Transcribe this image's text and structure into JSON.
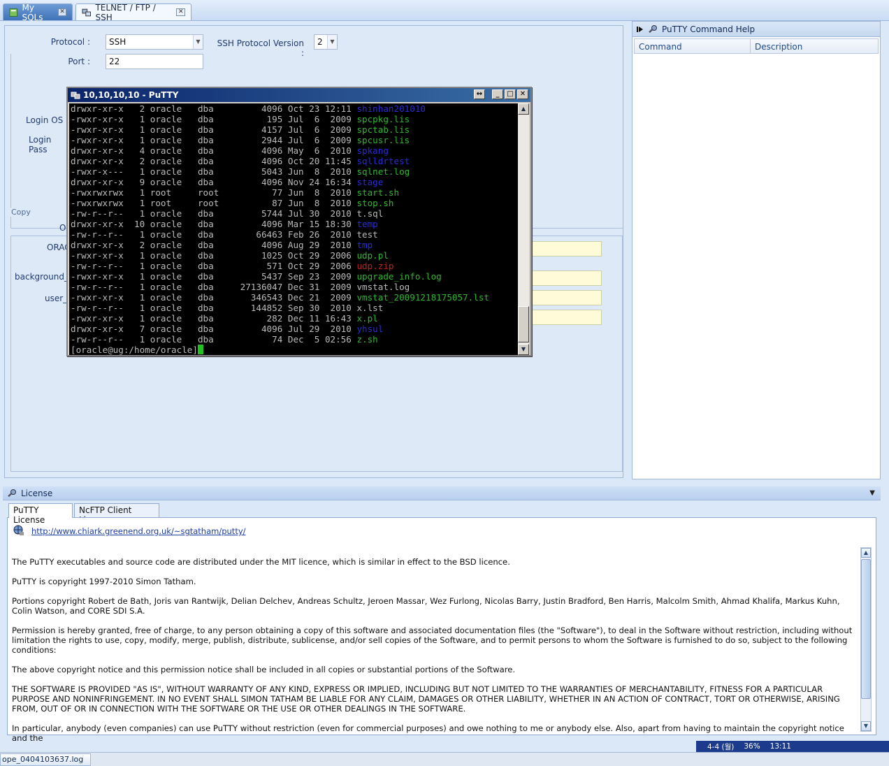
{
  "tabs": [
    {
      "label": "My SQLs",
      "active": false
    },
    {
      "label": "TELNET / FTP / SSH",
      "active": true
    }
  ],
  "form": {
    "protocol_label": "Protocol :",
    "protocol_value": "SSH",
    "ssh_version_label": "SSH Protocol Version :",
    "ssh_version_value": "2",
    "port_label": "Port :",
    "port_value": "22",
    "login_os_label": "Login OS",
    "login_pass_label": "Login Pass",
    "copy_legend": "Copy",
    "o_label": "O",
    "orac_label": "ORAC",
    "background_label": "background_c",
    "user_label": "user_c"
  },
  "putty": {
    "title": "10,10,10,10 - PuTTY",
    "lines": [
      {
        "p": "drwxr-xr-x   2 oracle   dba         4096 Oct 23 12:11 ",
        "n": "shinhan201010",
        "c": "c-blue"
      },
      {
        "p": "-rwxr-xr-x   1 oracle   dba          195 Jul  6  2009 ",
        "n": "spcpkg.lis",
        "c": "c-green"
      },
      {
        "p": "-rwxr-xr-x   1 oracle   dba         4157 Jul  6  2009 ",
        "n": "spctab.lis",
        "c": "c-green"
      },
      {
        "p": "-rwxr-xr-x   1 oracle   dba         2944 Jul  6  2009 ",
        "n": "spcusr.lis",
        "c": "c-green"
      },
      {
        "p": "drwxr-xr-x   4 oracle   dba         4096 May  6  2010 ",
        "n": "spkang",
        "c": "c-blue"
      },
      {
        "p": "drwxr-xr-x   2 oracle   dba         4096 Oct 20 11:45 ",
        "n": "sqlldrtest",
        "c": "c-blue"
      },
      {
        "p": "-rwxr-x---   1 oracle   dba         5043 Jun  8  2010 ",
        "n": "sqlnet.log",
        "c": "c-green"
      },
      {
        "p": "drwxr-xr-x   9 oracle   dba         4096 Nov 24 16:34 ",
        "n": "stage",
        "c": "c-blue"
      },
      {
        "p": "-rwxrwxrwx   1 root     root          77 Jun  8  2010 ",
        "n": "start.sh",
        "c": "c-green"
      },
      {
        "p": "-rwxrwxrwx   1 root     root          87 Jun  8  2010 ",
        "n": "stop.sh",
        "c": "c-green"
      },
      {
        "p": "-rw-r--r--   1 oracle   dba         5744 Jul 30  2010 ",
        "n": "t.sql",
        "c": "c-gray"
      },
      {
        "p": "drwxr-xr-x  10 oracle   dba         4096 Mar 15 18:30 ",
        "n": "temp",
        "c": "c-blue"
      },
      {
        "p": "-rw-r--r--   1 oracle   dba        66463 Feb 26  2010 ",
        "n": "test",
        "c": "c-gray"
      },
      {
        "p": "drwxr-xr-x   2 oracle   dba         4096 Aug 29  2010 ",
        "n": "tmp",
        "c": "c-blue"
      },
      {
        "p": "-rwxr-xr-x   1 oracle   dba         1025 Oct 29  2006 ",
        "n": "udp.pl",
        "c": "c-green"
      },
      {
        "p": "-rw-r--r--   1 oracle   dba          571 Oct 29  2006 ",
        "n": "udp.zip",
        "c": "c-red"
      },
      {
        "p": "-rwxr-xr-x   1 oracle   dba         5437 Sep 23  2009 ",
        "n": "upgrade_info.log",
        "c": "c-green"
      },
      {
        "p": "-rw-r--r--   1 oracle   dba     27136047 Dec 31  2009 ",
        "n": "vmstat.log",
        "c": "c-gray"
      },
      {
        "p": "-rwxr-xr-x   1 oracle   dba       346543 Dec 21  2009 ",
        "n": "vmstat_20091218175057.lst",
        "c": "c-green"
      },
      {
        "p": "-rw-r--r--   1 oracle   dba       144852 Sep 30  2010 ",
        "n": "x.lst",
        "c": "c-gray"
      },
      {
        "p": "-rwxr-xr-x   1 oracle   dba          282 Dec 11 16:43 ",
        "n": "x.pl",
        "c": "c-green"
      },
      {
        "p": "drwxr-xr-x   7 oracle   dba         4096 Jul 29  2010 ",
        "n": "yhsul",
        "c": "c-blue"
      },
      {
        "p": "-rw-r--r--   1 oracle   dba           74 Dec  5 02:56 ",
        "n": "z.sh",
        "c": "c-green"
      }
    ],
    "prompt": "[oracle@ug:/home/oracle]"
  },
  "help": {
    "title": "PuTTY Command Help",
    "col_command": "Command",
    "col_description": "Description"
  },
  "license": {
    "title": "License",
    "tabs": [
      "PuTTY License",
      "NcFTP Client License"
    ],
    "link": "http://www.chiark.greenend.org.uk/~sgtatham/putty/",
    "paragraphs": [
      "The PuTTY executables and source code are distributed under the MIT licence, which is similar in effect to the BSD licence.",
      "PuTTY is copyright 1997-2010 Simon Tatham.",
      "Portions copyright Robert de Bath, Joris van Rantwijk, Delian Delchev, Andreas Schultz, Jeroen Massar, Wez Furlong, Nicolas Barry, Justin Bradford, Ben Harris, Malcolm Smith, Ahmad Khalifa, Markus Kuhn, Colin Watson, and CORE SDI S.A.",
      "Permission is hereby granted, free of charge, to any person obtaining a copy of this software and associated documentation files (the \"Software\"), to deal in the Software without restriction, including without limitation the rights to use, copy, modify, merge, publish, distribute, sublicense, and/or sell copies of the Software, and to permit persons to whom the Software is furnished to do so, subject to the following conditions:",
      "The above copyright notice and this permission notice shall be included in all copies or substantial portions of the Software.",
      "THE SOFTWARE IS PROVIDED \"AS IS\", WITHOUT WARRANTY OF ANY KIND, EXPRESS OR IMPLIED, INCLUDING BUT NOT LIMITED TO THE WARRANTIES OF MERCHANTABILITY, FITNESS FOR A PARTICULAR PURPOSE AND NONINFRINGEMENT. IN NO EVENT SHALL SIMON TATHAM BE LIABLE FOR ANY CLAIM, DAMAGES OR OTHER LIABILITY, WHETHER IN AN ACTION OF CONTRACT, TORT OR OTHERWISE, ARISING FROM, OUT OF OR IN CONNECTION WITH THE SOFTWARE OR THE USE OR OTHER DEALINGS IN THE SOFTWARE.",
      "In particular, anybody (even companies) can use PuTTY without restriction (even for commercial purposes) and owe nothing to me or anybody else. Also, apart from having to maintain the copyright notice and the"
    ]
  },
  "status": {
    "position": "4-4 (월)",
    "percent": "36%",
    "time": "13:11"
  },
  "log_tab": "ope_0404103637.log"
}
